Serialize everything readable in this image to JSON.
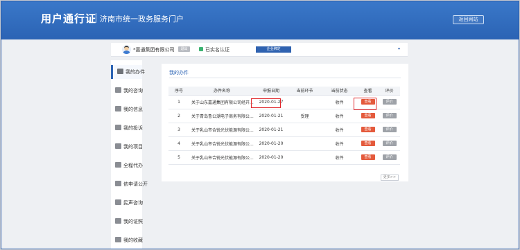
{
  "header": {
    "title": "用户通行证",
    "subtitle": "济南市统一政务服务门户",
    "back_label": "返回网站"
  },
  "userbar": {
    "company": "*嘉通集团有限公司",
    "tag": "退出",
    "verify_text": "已实名认证",
    "enterprise_btn": "企业绑定",
    "dropdown_icon": "▾"
  },
  "sidebar": {
    "items": [
      {
        "label": "我的办件",
        "icon": "bar-chart-icon"
      },
      {
        "label": "我的咨询",
        "icon": "chat-icon"
      },
      {
        "label": "我的信息",
        "icon": "star-icon"
      },
      {
        "label": "我的投诉",
        "icon": "complaint-icon"
      },
      {
        "label": "我的项目",
        "icon": "folder-icon"
      },
      {
        "label": "全程代办",
        "icon": "agent-icon"
      },
      {
        "label": "依申请公开",
        "icon": "disclosure-icon"
      },
      {
        "label": "民声咨询",
        "icon": "message-icon"
      },
      {
        "label": "我的证照",
        "icon": "certificate-icon"
      },
      {
        "label": "我的收藏",
        "icon": "favorite-icon"
      }
    ]
  },
  "main": {
    "tab": "我的办件",
    "columns": [
      "序号",
      "办件名称",
      "申报日期",
      "当前环节",
      "当前状态",
      "查看",
      "评价"
    ],
    "rows": [
      {
        "no": "1",
        "name": "关于山东嘉通集团有限公司经开...",
        "date": "2020-01-27",
        "stage": "",
        "status": "收件",
        "view": "查看",
        "eval": "评价"
      },
      {
        "no": "2",
        "name": "关于青岛鲁公潮电子商务有限公...",
        "date": "2020-01-21",
        "stage": "受理",
        "status": "收件",
        "view": "查看",
        "eval": "评价"
      },
      {
        "no": "3",
        "name": "关于乳山市合锐光伏能源有限公...",
        "date": "2020-01-21",
        "stage": "",
        "status": "收件",
        "view": "查看",
        "eval": "评价"
      },
      {
        "no": "4",
        "name": "关于乳山市合锐光伏能源有限公...",
        "date": "2020-01-20",
        "stage": "",
        "status": "收件",
        "view": "查看",
        "eval": "评价"
      },
      {
        "no": "5",
        "name": "关于乳山市合锐光伏能源有限公...",
        "date": "2020-01-20",
        "stage": "",
        "status": "收件",
        "view": "查看",
        "eval": "评价"
      }
    ],
    "more_label": "更多>>"
  },
  "colors": {
    "header_blue": "#2b63b4",
    "view_button": "#e45a3c",
    "eval_button": "#9ea2a8",
    "highlight": "#e0262a"
  }
}
